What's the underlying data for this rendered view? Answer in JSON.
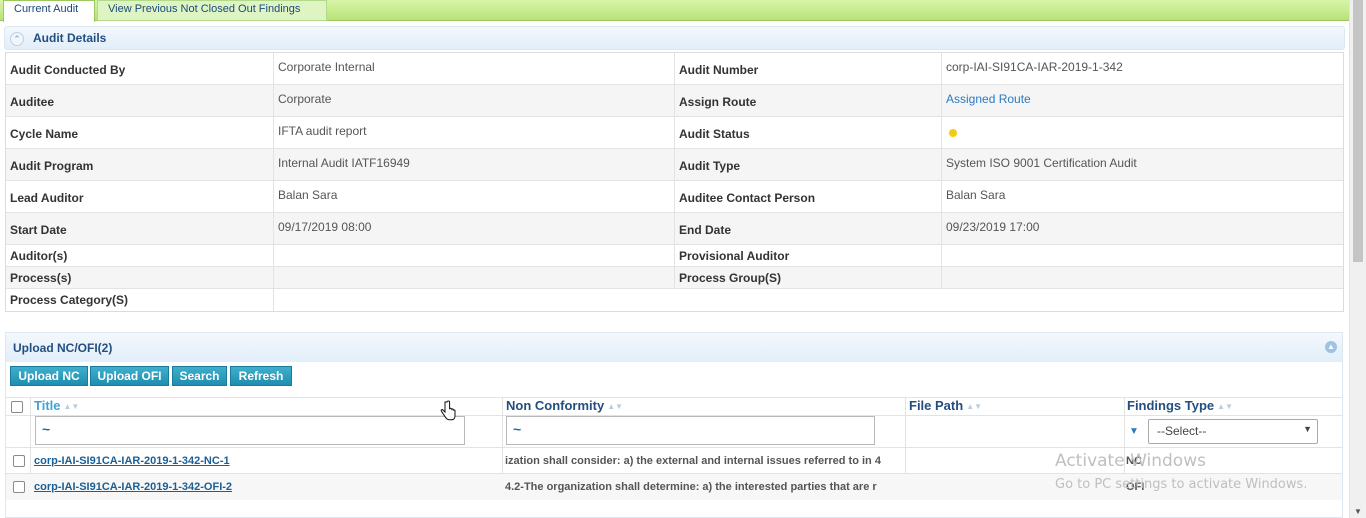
{
  "tabs": {
    "current": "Current Audit",
    "previous": "View Previous Not Closed Out Findings"
  },
  "audit_details": {
    "title": "Audit Details",
    "rows": [
      {
        "l1": "Audit Conducted By",
        "v1": "Corporate Internal",
        "l2": "Audit Number",
        "v2": "corp-IAI-SI91CA-IAR-2019-1-342"
      },
      {
        "l1": "Auditee",
        "v1": "Corporate",
        "l2": "Assign Route",
        "v2": "Assigned Route"
      },
      {
        "l1": "Cycle Name",
        "v1": "IFTA audit report",
        "l2": "Audit Status",
        "v2": ""
      },
      {
        "l1": "Audit Program",
        "v1": "Internal Audit IATF16949",
        "l2": "Audit Type",
        "v2": "System ISO 9001 Certification Audit"
      },
      {
        "l1": "Lead Auditor",
        "v1": "Balan Sara",
        "l2": "Auditee Contact Person",
        "v2": "Balan Sara"
      },
      {
        "l1": "Start Date",
        "v1": "09/17/2019 08:00",
        "l2": "End Date",
        "v2": "09/23/2019 17:00"
      },
      {
        "l1": "Auditor(s)",
        "v1": "",
        "l2": "Provisional Auditor",
        "v2": ""
      },
      {
        "l1": "Process(s)",
        "v1": "",
        "l2": "Process Group(S)",
        "v2": ""
      },
      {
        "l1": "Process Category(S)",
        "v1": ""
      }
    ],
    "status_color": "#f2cc0d"
  },
  "upload": {
    "title": "Upload NC/OFI(2)",
    "buttons": [
      "Upload NC",
      "Upload OFI",
      "Search",
      "Refresh"
    ],
    "columns": {
      "title": "Title",
      "non_conformity": "Non Conformity",
      "file_path": "File Path",
      "findings_type": "Findings Type"
    },
    "filters": {
      "title": "~",
      "non_conformity": "~",
      "findings_type": "--Select--"
    },
    "rows": [
      {
        "title": "corp-IAI-SI91CA-IAR-2019-1-342-NC-1",
        "non_conformity": "ization shall consider: a) the external and internal issues referred to in 4",
        "file_path": "",
        "type": "NC"
      },
      {
        "title": "corp-IAI-SI91CA-IAR-2019-1-342-OFI-2",
        "non_conformity": "4.2-The organization shall determine: a) the interested parties that are r",
        "file_path": "",
        "type": "OFI"
      }
    ]
  },
  "watermark": {
    "line1": "Activate Windows",
    "line2": "Go to PC settings to activate Windows."
  }
}
